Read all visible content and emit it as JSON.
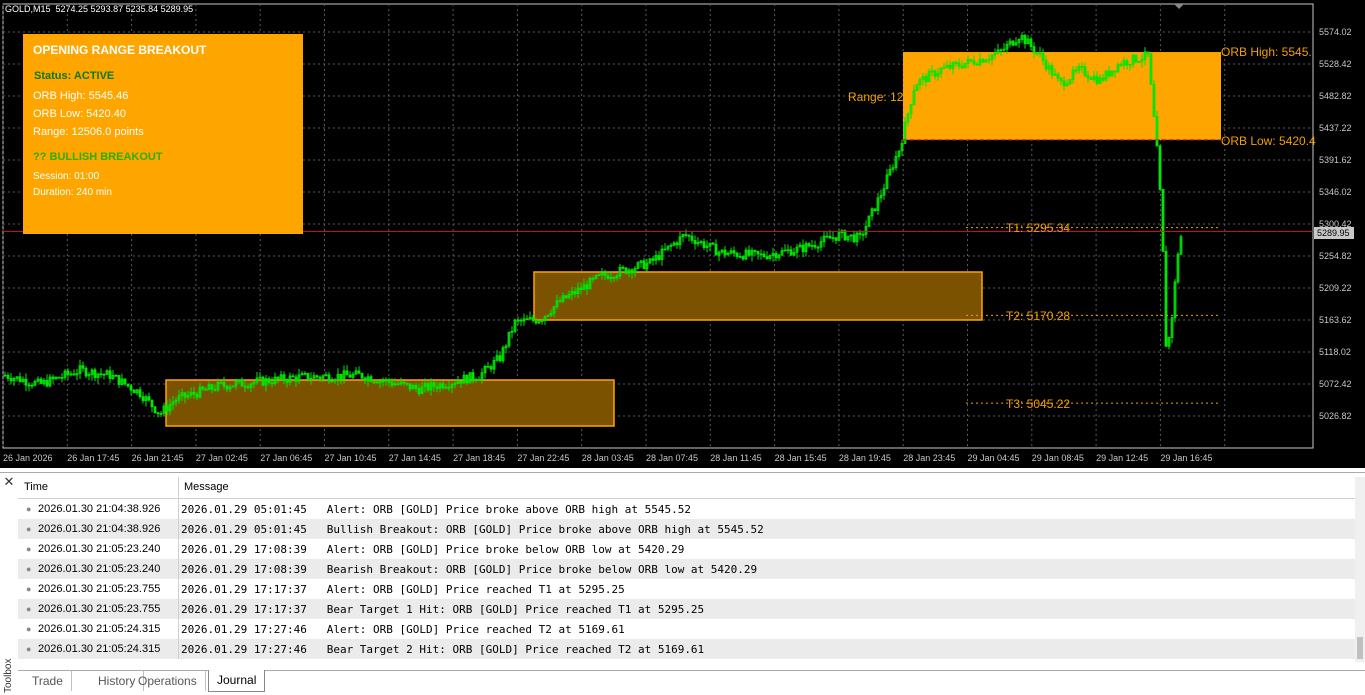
{
  "chart": {
    "header": "GOLD,M15  5274.25 5293.87 5235.84 5289.95",
    "price_scale": [
      "5574.02",
      "5528.42",
      "5482.82",
      "5437.22",
      "5391.62",
      "5346.02",
      "5300.42",
      "5254.82",
      "5209.22",
      "5163.62",
      "5118.02",
      "5072.42",
      "5026.82"
    ],
    "current_price": "5289.95",
    "time_scale": [
      "26 Jan 2026",
      "26 Jan 17:45",
      "26 Jan 21:45",
      "27 Jan 02:45",
      "27 Jan 06:45",
      "27 Jan 10:45",
      "27 Jan 14:45",
      "27 Jan 18:45",
      "27 Jan 22:45",
      "28 Jan 03:45",
      "28 Jan 07:45",
      "28 Jan 11:45",
      "28 Jan 15:45",
      "28 Jan 19:45",
      "28 Jan 23:45",
      "29 Jan 04:45",
      "29 Jan 08:45",
      "29 Jan 12:45",
      "29 Jan 16:45"
    ],
    "labels": {
      "orb_high": "ORB High: 5545.",
      "orb_low": "ORB Low: 5420.4",
      "range": "Range: 12",
      "t1": "T1: 5295.34",
      "t2": "T2: 5170.28",
      "t3": "T3: 5045.22"
    },
    "colors": {
      "background": "#000000",
      "candles": "#00e600",
      "orb_box": "#ffa500",
      "hist_box": "#7a5200",
      "level": "#f0a000",
      "price_line": "#c02030"
    }
  },
  "panel": {
    "title": "OPENING RANGE BREAKOUT",
    "status": "Status: ACTIVE",
    "orb_high": "ORB High: 5545.46",
    "orb_low": "ORB Low:  5420.40",
    "range": "Range: 12506.0 points",
    "breakout": "?? BULLISH BREAKOUT",
    "session": "Session: 01:00",
    "duration": "Duration: 240 min"
  },
  "toolbox": {
    "side_label": "Toolbox",
    "columns": {
      "time": "Time",
      "message": "Message"
    },
    "rows": [
      {
        "time": "2026.01.30 21:04:38.926",
        "message": "2026.01.29 05:01:45   Alert: ORB [GOLD] Price broke above ORB high at 5545.52"
      },
      {
        "time": "2026.01.30 21:04:38.926",
        "message": "2026.01.29 05:01:45   Bullish Breakout: ORB [GOLD] Price broke above ORB high at 5545.52"
      },
      {
        "time": "2026.01.30 21:05:23.240",
        "message": "2026.01.29 17:08:39   Alert: ORB [GOLD] Price broke below ORB low at 5420.29"
      },
      {
        "time": "2026.01.30 21:05:23.240",
        "message": "2026.01.29 17:08:39   Bearish Breakout: ORB [GOLD] Price broke below ORB low at 5420.29"
      },
      {
        "time": "2026.01.30 21:05:23.755",
        "message": "2026.01.29 17:17:37   Alert: ORB [GOLD] Price reached T1 at 5295.25"
      },
      {
        "time": "2026.01.30 21:05:23.755",
        "message": "2026.01.29 17:17:37   Bear Target 1 Hit: ORB [GOLD] Price reached T1 at 5295.25"
      },
      {
        "time": "2026.01.30 21:05:24.315",
        "message": "2026.01.29 17:27:46   Alert: ORB [GOLD] Price reached T2 at 5169.61"
      },
      {
        "time": "2026.01.30 21:05:24.315",
        "message": "2026.01.29 17:27:46   Bear Target 2 Hit: ORB [GOLD] Price reached T2 at 5169.61"
      }
    ],
    "tabs": [
      "Trade",
      "History",
      "Operations",
      "Journal"
    ],
    "active_tab": "Journal"
  }
}
